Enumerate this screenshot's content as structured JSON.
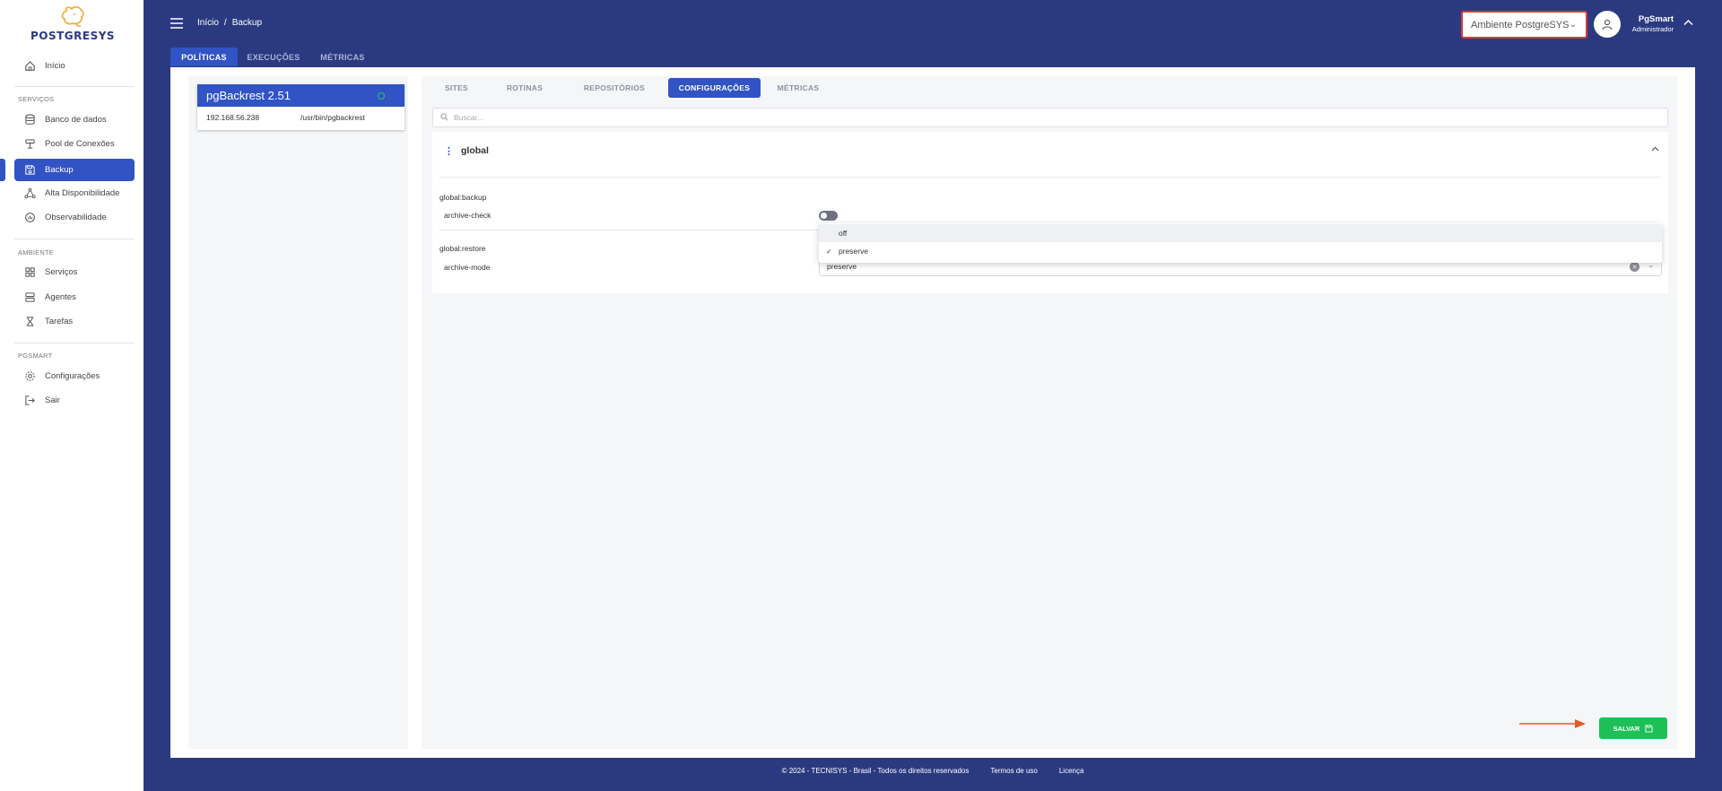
{
  "brand": {
    "name": "POSTGRESYS"
  },
  "sidebar": {
    "items": [
      {
        "label": "Início",
        "icon": "home-icon"
      },
      {
        "label": "Banco de dados",
        "icon": "database-icon"
      },
      {
        "label": "Pool de Conexões",
        "icon": "connection-pool-icon"
      },
      {
        "label": "Backup",
        "icon": "backup-icon",
        "active": true
      },
      {
        "label": "Alta Disponibilidade",
        "icon": "high-availability-icon"
      },
      {
        "label": "Observabilidade",
        "icon": "observability-icon"
      },
      {
        "label": "Serviços",
        "icon": "services-icon"
      },
      {
        "label": "Agentes",
        "icon": "agents-icon"
      },
      {
        "label": "Tarefas",
        "icon": "hourglass-icon"
      },
      {
        "label": "Configurações",
        "icon": "gear-icon"
      },
      {
        "label": "Sair",
        "icon": "logout-icon"
      }
    ],
    "sections": {
      "servicos": "SERVIÇOS",
      "ambiente": "AMBIENTE",
      "pgsmart": "PGSMART"
    }
  },
  "header": {
    "breadcrumb": {
      "home": "Início",
      "sep": "/",
      "current": "Backup"
    },
    "environment": "Ambiente PostgreSYS",
    "user": {
      "name": "PgSmart",
      "role": "Administrador"
    }
  },
  "top_tabs": [
    "POLÍTICAS",
    "EXECUÇÕES",
    "MÉTRICAS"
  ],
  "top_tabs_active": "POLÍTICAS",
  "server_card": {
    "title": "pgBackrest 2.51",
    "ip": "192.168.56.238",
    "path": "/usr/bin/pgbackrest",
    "status_color": "#27c46b"
  },
  "sub_tabs": [
    "SITES",
    "ROTINAS",
    "REPOSITÓRIOS",
    "CONFIGURAÇÕES",
    "MÉTRICAS"
  ],
  "sub_tabs_active": "CONFIGURAÇÕES",
  "search": {
    "placeholder": "Buscar..."
  },
  "config": {
    "section_title": "global",
    "groups": [
      {
        "label": "global:backup",
        "field": "archive-check",
        "type": "toggle",
        "value": false
      },
      {
        "label": "global:restore",
        "field": "archive-mode",
        "type": "select",
        "value": "preserve"
      }
    ],
    "dropdown_options": [
      "off",
      "preserve"
    ],
    "dropdown_selected": "preserve"
  },
  "save_button": {
    "label": "SALVAR"
  },
  "footer": {
    "copyright": "© 2024 - TECNISYS - Brasil - Todos os direitos reservados",
    "terms": "Termos de uso",
    "license": "Licença"
  },
  "colors": {
    "primary": "#3153c4",
    "header_bg": "#2b3a80",
    "success": "#1fbf57",
    "alert": "#d9393a",
    "arrow": "#e05a2a"
  }
}
